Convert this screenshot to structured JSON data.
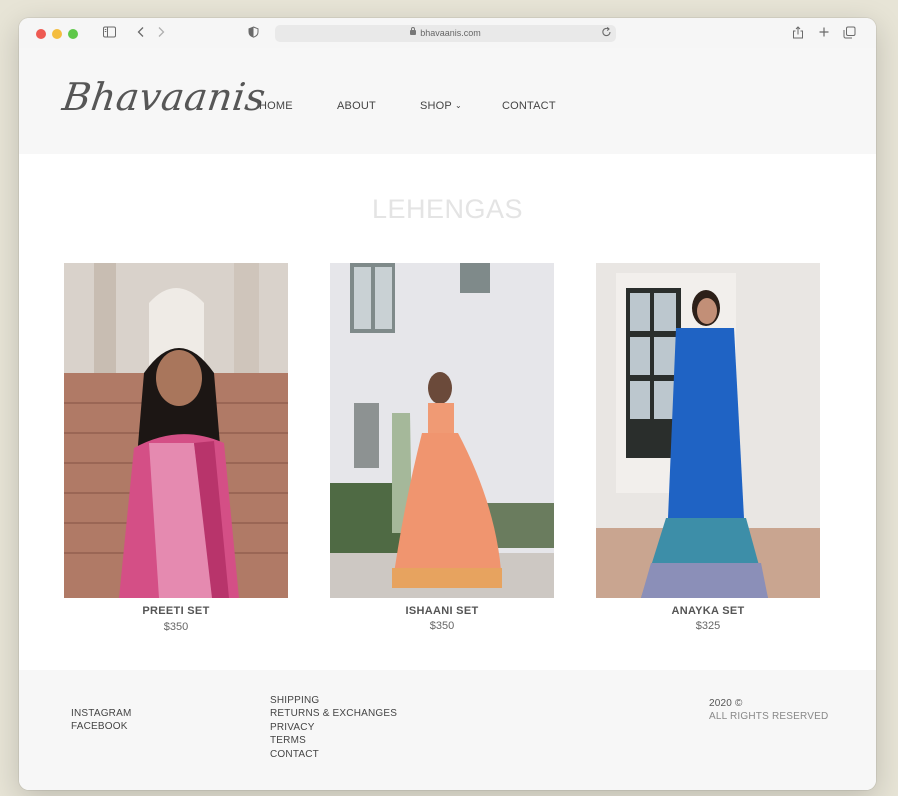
{
  "browser": {
    "url": "bhavaanis.com"
  },
  "site": {
    "logo": "Bhavaanis",
    "nav": {
      "home": "HOME",
      "about": "ABOUT",
      "shop": "SHOP",
      "contact": "CONTACT"
    }
  },
  "main": {
    "title": "LEHENGAS",
    "products": [
      {
        "name": "PREETI SET",
        "price": "$350"
      },
      {
        "name": "ISHAANI SET",
        "price": "$350"
      },
      {
        "name": "ANAYKA SET",
        "price": "$325"
      }
    ]
  },
  "footer": {
    "social": [
      "INSTAGRAM",
      "FACEBOOK"
    ],
    "links": [
      "SHIPPING",
      "RETURNS & EXCHANGES",
      "PRIVACY",
      "TERMS",
      "CONTACT"
    ],
    "year": "2020 ©",
    "rights": "ALL RIGHTS RESERVED"
  },
  "colors": {
    "page_bg": "#e7e4d6",
    "header_bg": "#f7f7f7",
    "title_color": "#e4e4e4"
  }
}
